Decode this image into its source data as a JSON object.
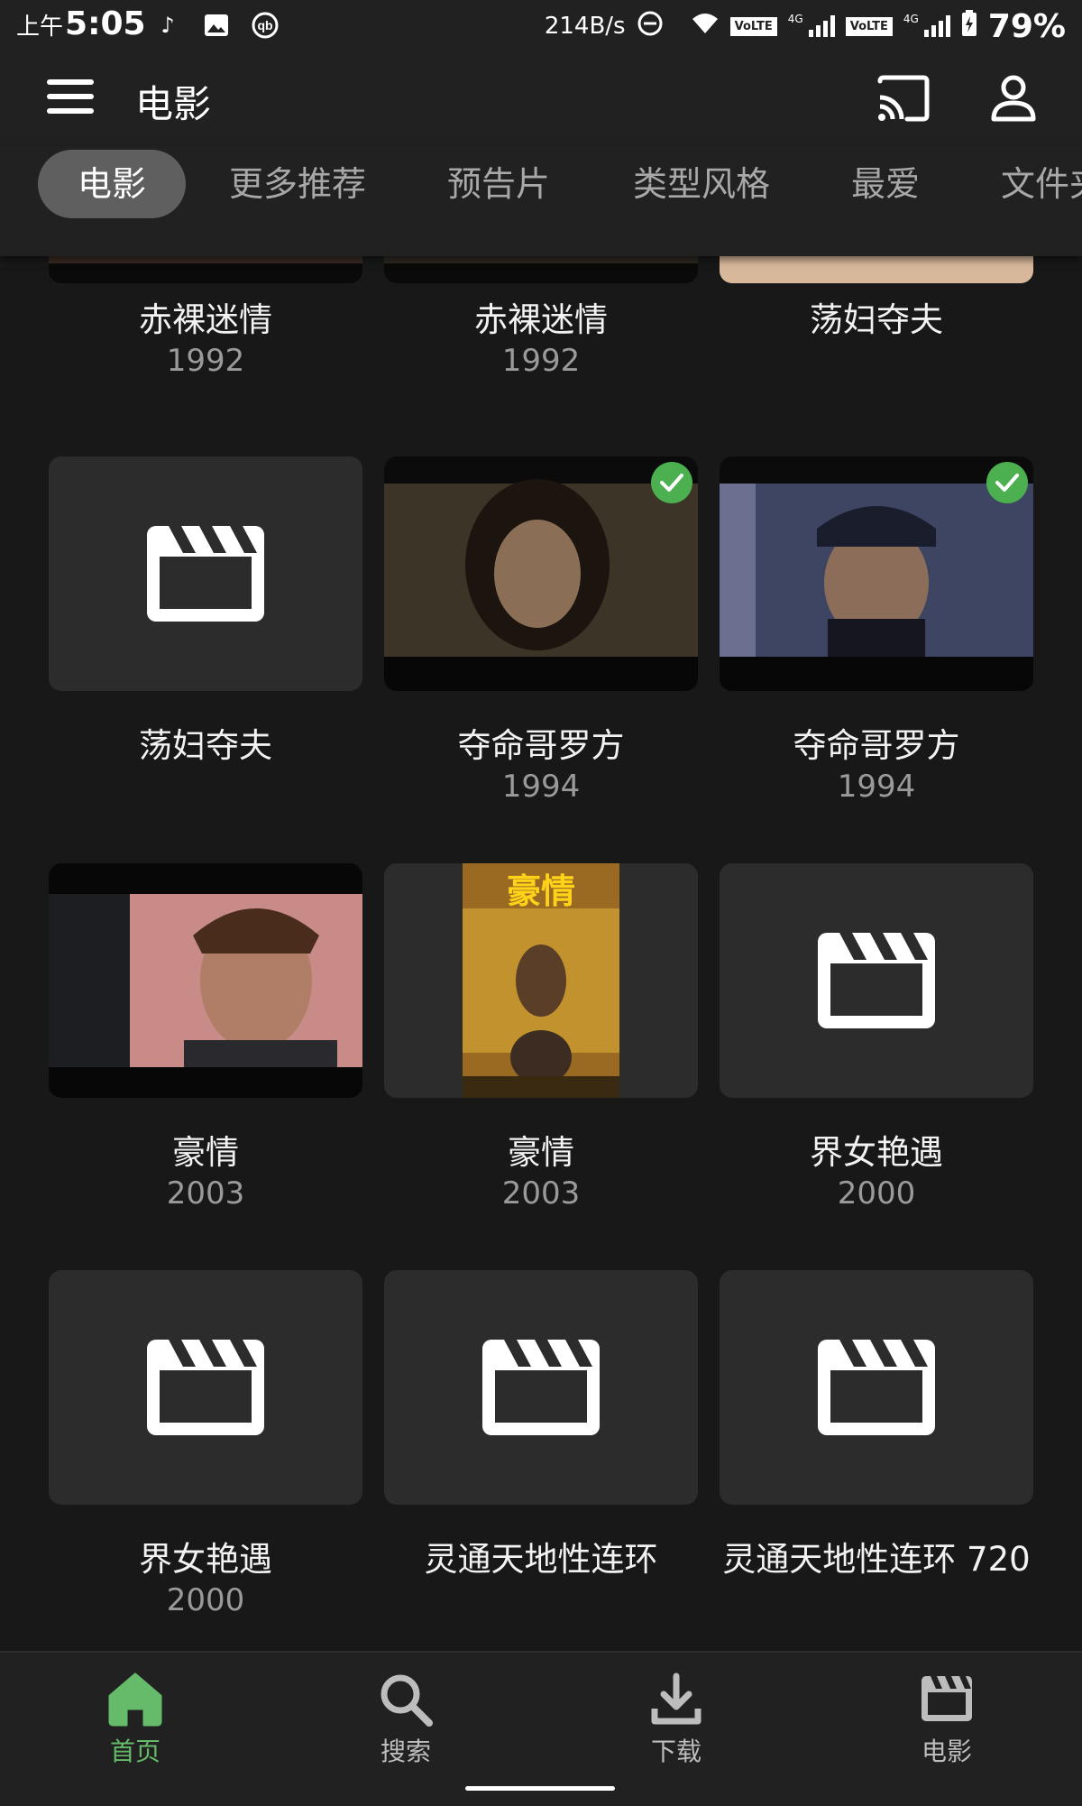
{
  "status_bar": {
    "time_prefix": "上午",
    "time": "5:05",
    "net_speed": "214B/s",
    "volte_1": "VoLTE",
    "volte_2": "VoLTE",
    "net_1": "4G",
    "net_2": "4G",
    "battery": "79%"
  },
  "app_bar": {
    "title": "电影"
  },
  "tabs": [
    {
      "label": "电影",
      "active": true
    },
    {
      "label": "更多推荐"
    },
    {
      "label": "预告片"
    },
    {
      "label": "类型风格"
    },
    {
      "label": "最爱"
    },
    {
      "label": "文件夹"
    }
  ],
  "movies": [
    {
      "title": "赤裸迷情",
      "year": "1992"
    },
    {
      "title": "赤裸迷情",
      "year": "1992"
    },
    {
      "title": "荡妇夺夫",
      "year": ""
    },
    {
      "title": "荡妇夺夫",
      "year": ""
    },
    {
      "title": "夺命哥罗方",
      "year": "1994",
      "watched": true
    },
    {
      "title": "夺命哥罗方",
      "year": "1994",
      "watched": true
    },
    {
      "title": "豪情",
      "year": "2003"
    },
    {
      "title": "豪情",
      "year": "2003",
      "poster_text": "豪情"
    },
    {
      "title": "界女艳遇",
      "year": "2000"
    },
    {
      "title": "界女艳遇",
      "year": "2000"
    },
    {
      "title": "灵通天地性连环",
      "year": ""
    },
    {
      "title": "灵通天地性连环 720",
      "year": ""
    }
  ],
  "bottom_nav": [
    {
      "label": "首页",
      "icon": "home-icon",
      "active": true
    },
    {
      "label": "搜索",
      "icon": "search-icon"
    },
    {
      "label": "下载",
      "icon": "download-icon"
    },
    {
      "label": "电影",
      "icon": "movies-icon"
    }
  ],
  "colors": {
    "accent": "#66bb6a",
    "watched_badge": "#4caf50",
    "background": "#181818",
    "bar": "#212121"
  }
}
